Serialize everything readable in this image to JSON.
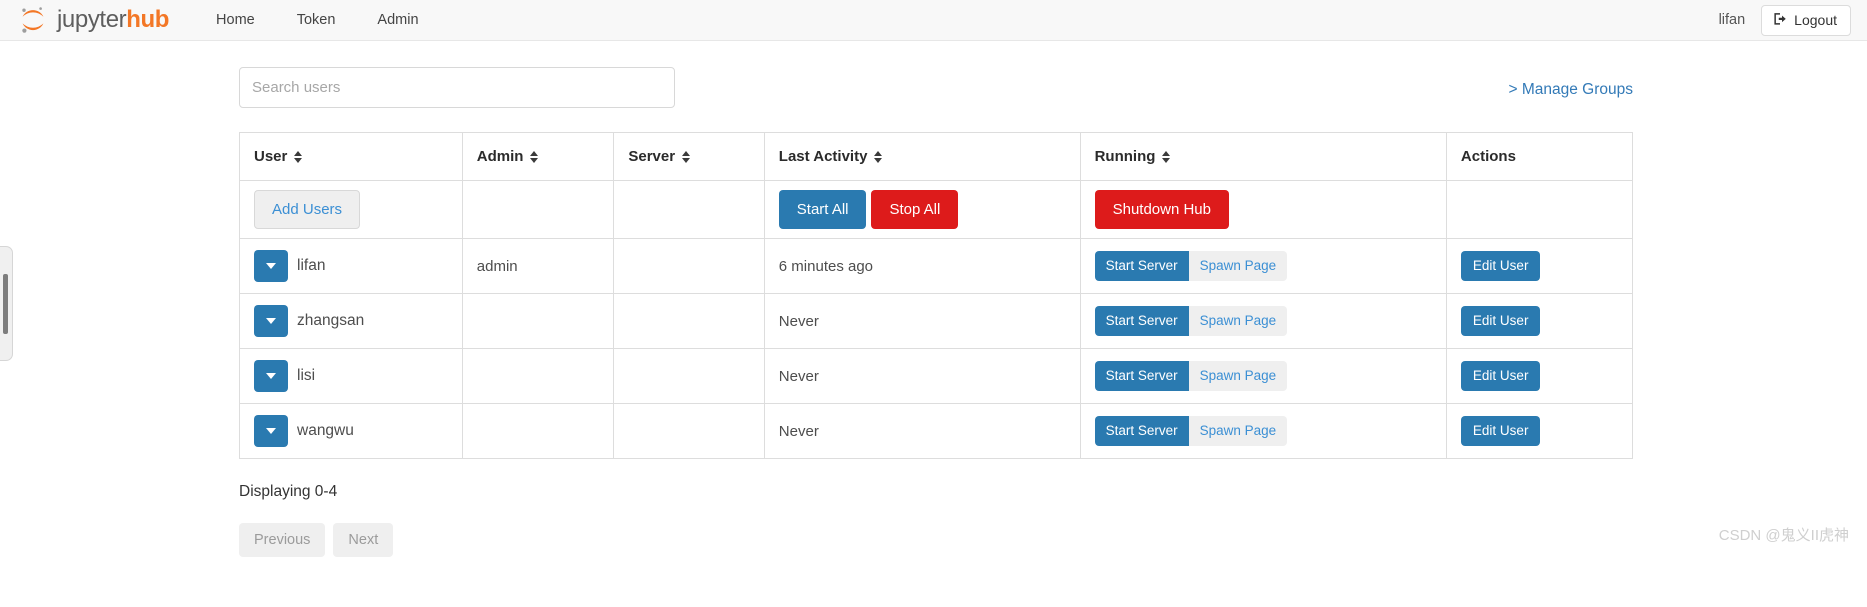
{
  "navbar": {
    "brand_first": "jupyter",
    "brand_second": "hub",
    "logo_icon": "jupyter-logo-icon",
    "links": [
      {
        "label": "Home"
      },
      {
        "label": "Token"
      },
      {
        "label": "Admin"
      }
    ],
    "username": "lifan",
    "logout_label": "Logout",
    "logout_icon": "logout-icon"
  },
  "toolbar": {
    "search_placeholder": "Search users",
    "search_value": "",
    "manage_groups_label": "> Manage Groups"
  },
  "table": {
    "columns": [
      {
        "label": "User",
        "sortable": true
      },
      {
        "label": "Admin",
        "sortable": true
      },
      {
        "label": "Server",
        "sortable": true
      },
      {
        "label": "Last Activity",
        "sortable": true
      },
      {
        "label": "Running",
        "sortable": true
      },
      {
        "label": "Actions",
        "sortable": false
      }
    ],
    "action_row": {
      "add_users_label": "Add Users",
      "start_all_label": "Start All",
      "stop_all_label": "Stop All",
      "shutdown_hub_label": "Shutdown Hub"
    },
    "rows": [
      {
        "user": "lifan",
        "admin": "admin",
        "server": "",
        "last_activity": "6 minutes ago",
        "running_primary": "Start Server",
        "running_secondary": "Spawn Page",
        "action": "Edit User"
      },
      {
        "user": "zhangsan",
        "admin": "",
        "server": "",
        "last_activity": "Never",
        "running_primary": "Start Server",
        "running_secondary": "Spawn Page",
        "action": "Edit User"
      },
      {
        "user": "lisi",
        "admin": "",
        "server": "",
        "last_activity": "Never",
        "running_primary": "Start Server",
        "running_secondary": "Spawn Page",
        "action": "Edit User"
      },
      {
        "user": "wangwu",
        "admin": "",
        "server": "",
        "last_activity": "Never",
        "running_primary": "Start Server",
        "running_secondary": "Spawn Page",
        "action": "Edit User"
      }
    ]
  },
  "footer": {
    "displaying_label": "Displaying 0-4",
    "previous_label": "Previous",
    "next_label": "Next"
  },
  "watermark": {
    "text": "CSDN @鬼义II虎神"
  },
  "colors": {
    "brand_orange": "#f37726",
    "primary_blue": "#2a7ab0",
    "link_blue": "#337ab7",
    "danger_red": "#dd1b1b",
    "navbar_bg": "#f8f8f8",
    "border": "#dddddd"
  }
}
